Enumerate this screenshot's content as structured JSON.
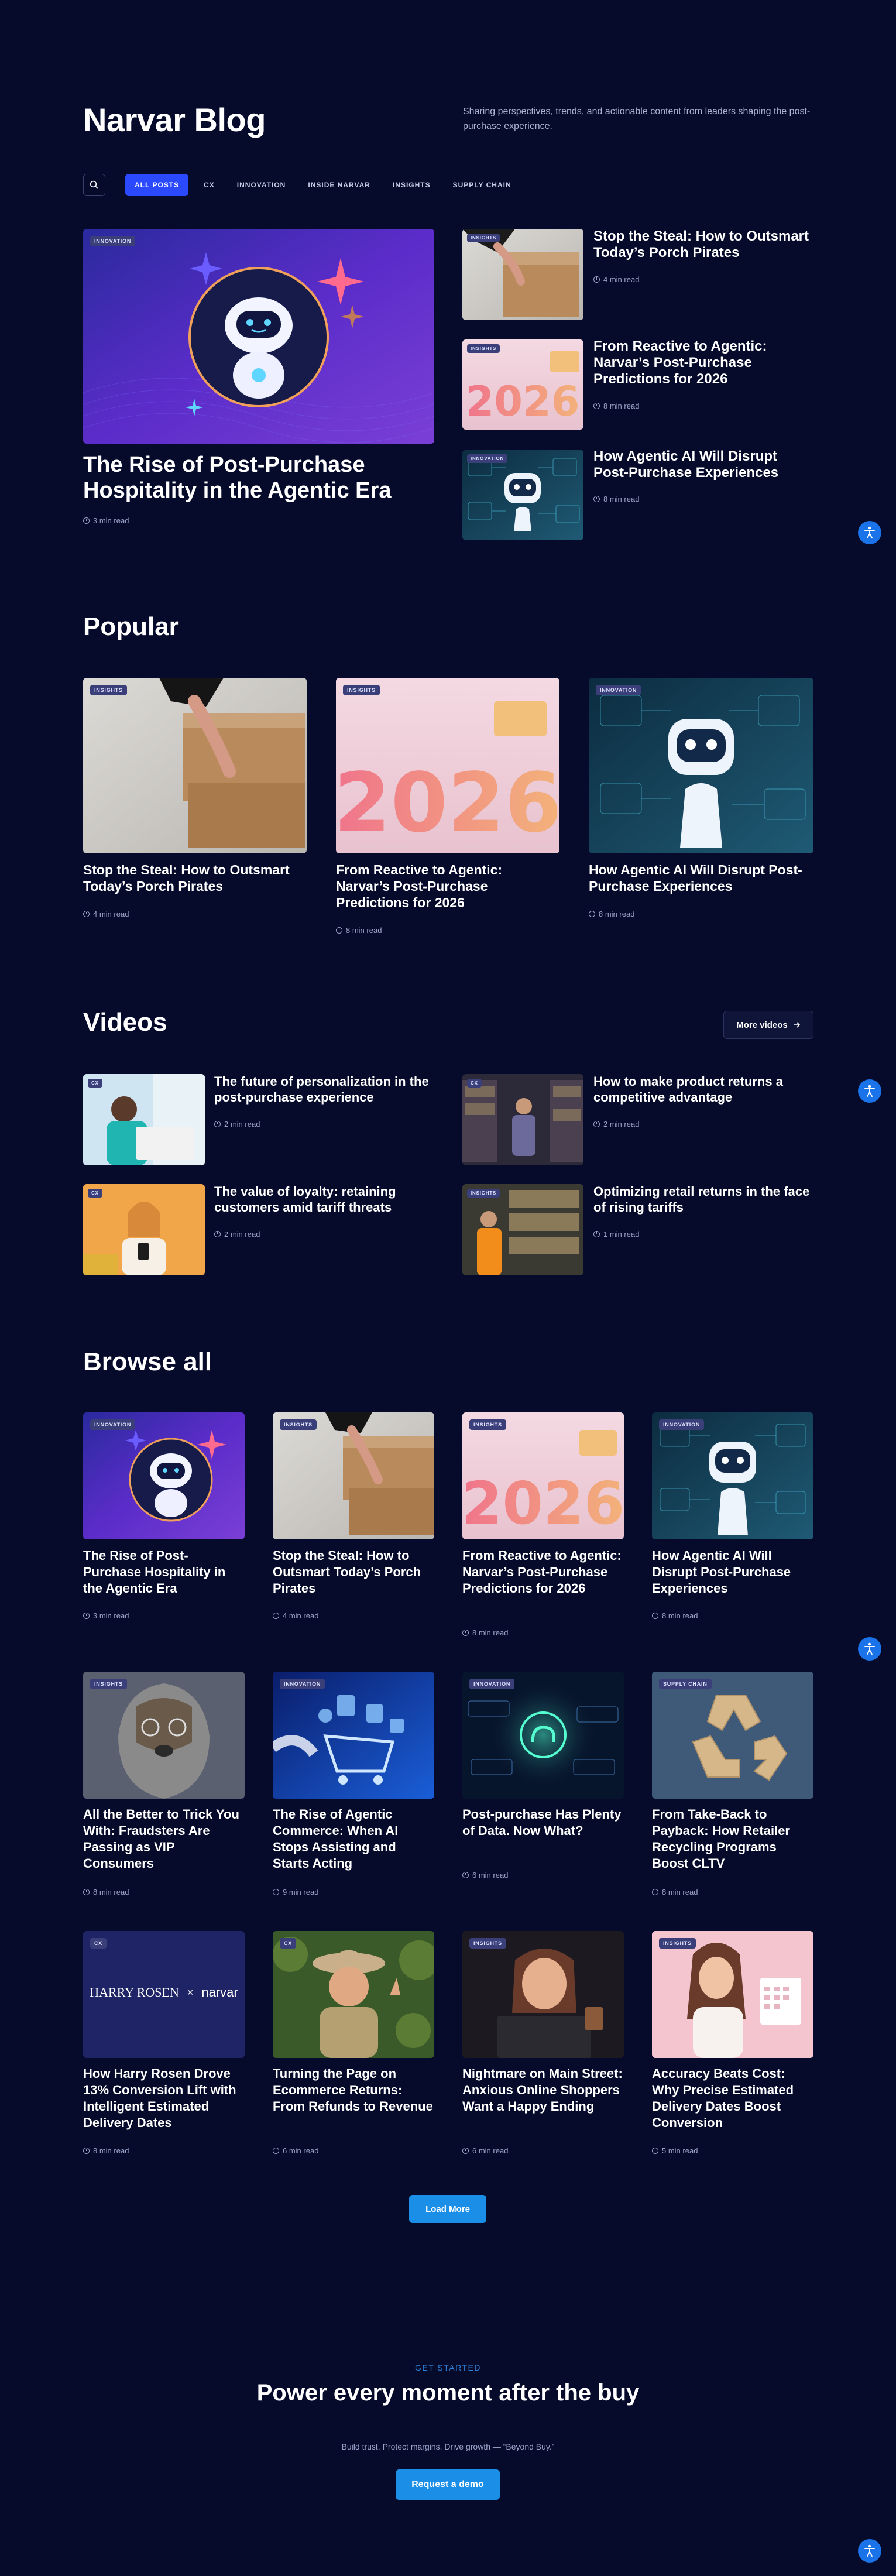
{
  "header": {
    "title": "Narvar Blog",
    "description": "Sharing perspectives, trends, and actionable content from leaders shaping the post-purchase experience."
  },
  "filters": [
    "ALL POSTS",
    "CX",
    "INNOVATION",
    "INSIDE NARVAR",
    "INSIGHTS",
    "SUPPLY CHAIN"
  ],
  "featured": {
    "main": {
      "badge": "INNOVATION",
      "title": "The Rise of Post-Purchase Hospitality in the Agentic Era",
      "read": "3 min read"
    },
    "side": [
      {
        "badge": "INSIGHTS",
        "title": "Stop the Steal: How to Outsmart Today’s Porch Pirates",
        "read": "4 min read"
      },
      {
        "badge": "INSIGHTS",
        "title": "From Reactive to Agentic: Narvar’s Post-Purchase Predictions for 2026",
        "read": "8 min read"
      },
      {
        "badge": "INNOVATION",
        "title": "How Agentic AI Will Disrupt Post-Purchase Experiences",
        "read": "8 min read"
      }
    ]
  },
  "popular": {
    "title": "Popular",
    "items": [
      {
        "badge": "INSIGHTS",
        "title": "Stop the Steal: How to Outsmart Today’s Porch Pirates",
        "read": "4 min read"
      },
      {
        "badge": "INSIGHTS",
        "title": "From Reactive to Agentic: Narvar’s Post-Purchase Predictions for 2026",
        "read": "8 min read"
      },
      {
        "badge": "INNOVATION",
        "title": "How Agentic AI Will Disrupt Post-Purchase Experiences",
        "read": "8 min read"
      }
    ]
  },
  "videos": {
    "title": "Videos",
    "more_label": "More videos",
    "items": [
      {
        "badge": "CX",
        "title": "The future of personalization in the post-purchase experience",
        "read": "2 min read"
      },
      {
        "badge": "CX",
        "title": "How to make product returns a competitive advantage",
        "read": "2 min read"
      },
      {
        "badge": "CX",
        "title": "The value of loyalty: retaining customers amid tariff threats",
        "read": "2 min read"
      },
      {
        "badge": "INSIGHTS",
        "title": "Optimizing retail returns in the face of rising tariffs",
        "read": "1 min read"
      }
    ]
  },
  "browse": {
    "title": "Browse all",
    "items": [
      {
        "badge": "INNOVATION",
        "title": "The Rise of Post-Purchase Hospitality in the Agentic Era",
        "read": "3 min read"
      },
      {
        "badge": "INSIGHTS",
        "title": "Stop the Steal: How to Outsmart Today’s Porch Pirates",
        "read": "4 min read"
      },
      {
        "badge": "INSIGHTS",
        "title": "From Reactive to Agentic: Narvar’s Post-Purchase Predictions for 2026",
        "read": "8 min read"
      },
      {
        "badge": "INNOVATION",
        "title": "How Agentic AI Will Disrupt Post-Purchase Experiences",
        "read": "8 min read"
      },
      {
        "badge": "INSIGHTS",
        "title": "All the Better to Trick You With: Fraudsters Are Passing as VIP Consumers",
        "read": "8 min read"
      },
      {
        "badge": "INNOVATION",
        "title": "The Rise of Agentic Commerce: When AI Stops Assisting and Starts Acting",
        "read": "9 min read"
      },
      {
        "badge": "INNOVATION",
        "title": "Post-purchase Has Plenty of Data. Now What?",
        "read": "6 min read"
      },
      {
        "badge": "SUPPLY CHAIN",
        "title": "From Take-Back to Payback: How Retailer Recycling Programs Boost CLTV",
        "read": "8 min read"
      },
      {
        "badge": "CX",
        "title": "How Harry Rosen Drove 13% Conversion Lift with Intelligent Estimated Delivery Dates",
        "read": "8 min read"
      },
      {
        "badge": "CX",
        "title": "Turning the Page on Ecommerce Returns: From Refunds to Revenue",
        "read": "6 min read"
      },
      {
        "badge": "INSIGHTS",
        "title": "Nightmare on Main Street: Anxious Online Shoppers Want a Happy Ending",
        "read": "6 min read"
      },
      {
        "badge": "INSIGHTS",
        "title": "Accuracy Beats Cost: Why Precise Estimated Delivery Dates Boost Conversion",
        "read": "5 min read"
      }
    ],
    "load_more": "Load More"
  },
  "harry_rosen_logo": {
    "left": "HARRY ROSEN",
    "x": "×",
    "right": "narvar"
  },
  "year_2026": "2026",
  "cta": {
    "eyebrow": "GET STARTED",
    "title": "Power every moment after the buy",
    "subtitle": "Build trust. Protect margins. Drive growth — “Beyond Buy.”",
    "button": "Request a demo"
  },
  "colors": {
    "background": "#060b2b",
    "accent": "#2b49ff",
    "button": "#1b8fe8"
  }
}
